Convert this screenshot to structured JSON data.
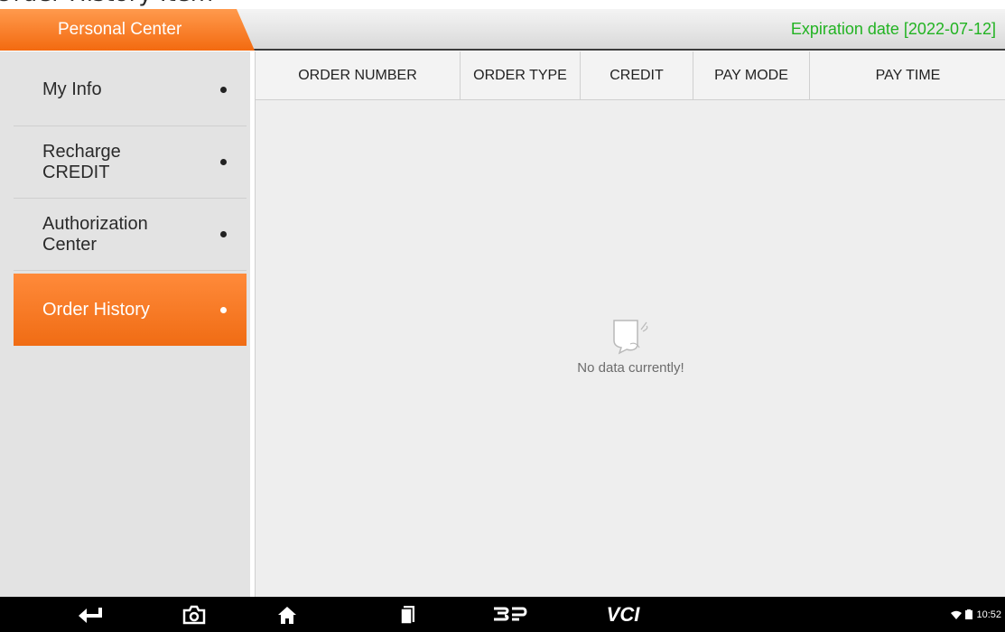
{
  "header": {
    "title": "Personal Center",
    "expiration": "Expiration date [2022-07-12]"
  },
  "sidebar": {
    "items": [
      {
        "label": "My Info",
        "active": false
      },
      {
        "label": "Recharge CREDIT",
        "active": false
      },
      {
        "label": "Authorization Center",
        "active": false
      },
      {
        "label": "Order History",
        "active": true
      }
    ]
  },
  "table": {
    "columns": [
      "ORDER NUMBER",
      "ORDER TYPE",
      "CREDIT",
      "PAY MODE",
      "PAY TIME"
    ],
    "rows": [],
    "empty_text": "No data currently!"
  },
  "navbar": {
    "icons": [
      "back-icon",
      "camera-icon",
      "home-icon",
      "recent-apps-icon",
      "dp-logo-icon"
    ],
    "vci_label": "VCI",
    "time": "10:52"
  },
  "colors": {
    "accent": "#f36a10",
    "expiry": "#22b322"
  }
}
